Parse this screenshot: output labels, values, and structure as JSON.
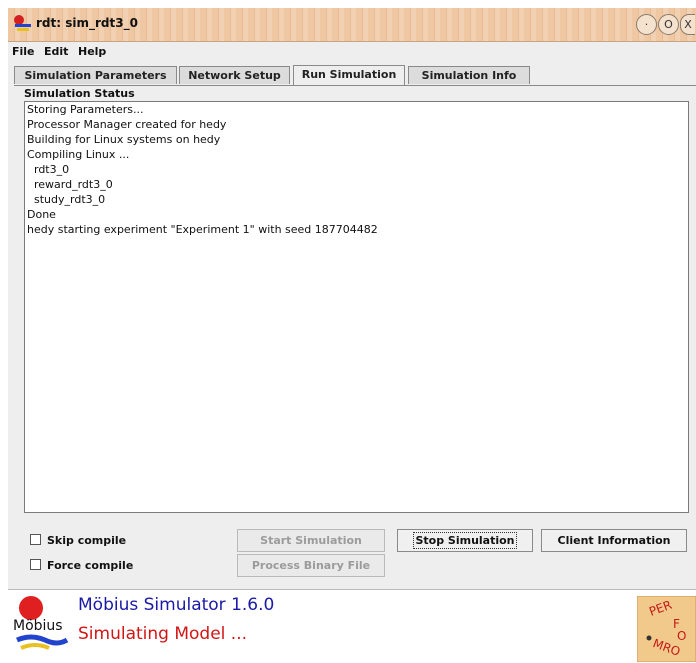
{
  "window": {
    "title": "rdt: sim_rdt3_0",
    "controls": [
      "·",
      "O",
      "X"
    ]
  },
  "menu": [
    "File",
    "Edit",
    "Help"
  ],
  "tabs": [
    {
      "label": "Simulation Parameters"
    },
    {
      "label": "Network Setup"
    },
    {
      "label": "Run Simulation",
      "active": true
    },
    {
      "label": "Simulation Info"
    }
  ],
  "status": {
    "label": "Simulation Status",
    "lines": [
      "Storing Parameters...",
      "Processor Manager created for hedy",
      "Building for Linux systems on hedy",
      "Compiling Linux ...",
      "  rdt3_0",
      "  reward_rdt3_0",
      "  study_rdt3_0",
      "Done",
      "hedy starting experiment \"Experiment 1\" with seed 187704482"
    ]
  },
  "options": {
    "skip_compile": "Skip compile",
    "force_compile": "Force compile"
  },
  "buttons": {
    "start": "Start Simulation",
    "process": "Process Binary File",
    "stop": "Stop Simulation",
    "client": "Client Information"
  },
  "footer": {
    "logo_text": "Möbius",
    "product": "Möbius Simulator 1.6.0",
    "activity": "Simulating Model ...",
    "perform_logo_text": "PERFORM"
  },
  "colors": {
    "title_bar": "#efc7a3",
    "product_text": "#1a1aa6",
    "activity_text": "#d41414"
  }
}
